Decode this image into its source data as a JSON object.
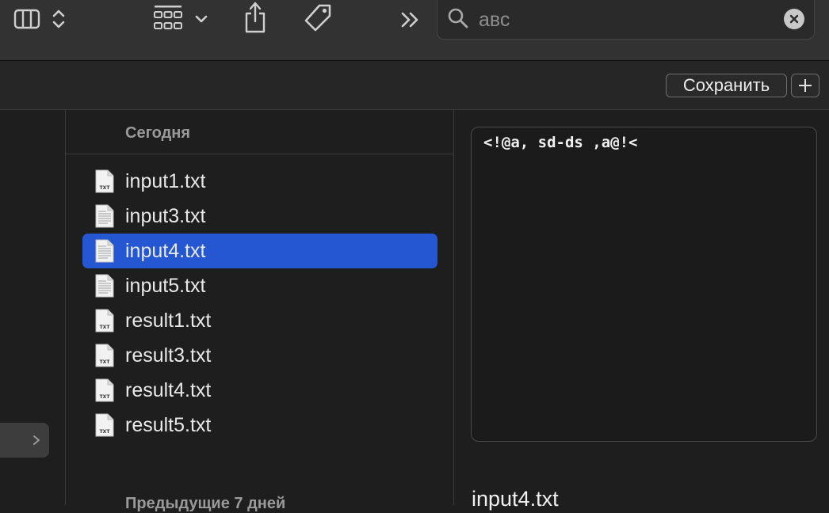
{
  "toolbar": {
    "icons": [
      "columns-view-icon",
      "sort-updown-icon",
      "group-grid-icon",
      "chevron-down-icon",
      "share-icon",
      "tag-icon",
      "overflow-chevrons-icon"
    ]
  },
  "search": {
    "value": "авс",
    "icon": "search-icon",
    "clear_icon": "clear-icon"
  },
  "savebar": {
    "save_label": "Сохранить",
    "plus_icon": "plus-icon"
  },
  "sections": {
    "today": "Сегодня",
    "previous": "Предыдущие 7 дней"
  },
  "files": [
    {
      "name": "input1.txt",
      "icon": "txt-file-icon"
    },
    {
      "name": "input3.txt",
      "icon": "text-document-icon"
    },
    {
      "name": "input4.txt",
      "icon": "text-document-icon",
      "selected": true
    },
    {
      "name": "input5.txt",
      "icon": "text-document-icon"
    },
    {
      "name": "result1.txt",
      "icon": "txt-file-icon"
    },
    {
      "name": "result3.txt",
      "icon": "txt-file-icon"
    },
    {
      "name": "result4.txt",
      "icon": "txt-file-icon"
    },
    {
      "name": "result5.txt",
      "icon": "txt-file-icon"
    }
  ],
  "preview": {
    "content": "<!@a, sd-ds ,a@!<",
    "filename": "input4.txt"
  },
  "colors": {
    "selection": "#2457d1",
    "toolbar": "#323232",
    "background": "#1e1e1e"
  }
}
